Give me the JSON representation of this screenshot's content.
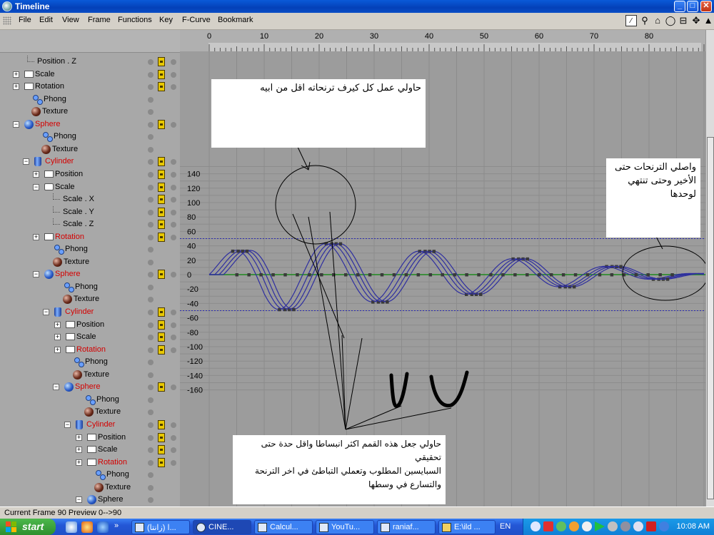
{
  "window": {
    "title": "Timeline",
    "minimize": "_",
    "maximize": "□",
    "close": "✕"
  },
  "menu": [
    "File",
    "Edit",
    "View",
    "Frame",
    "Functions",
    "Key",
    "F-Curve",
    "Bookmark"
  ],
  "toolbar_icons": [
    "fcurve-mode-icon",
    "zoom-icon",
    "home-icon",
    "frame-all-icon",
    "snap-icon",
    "move-icon",
    "warning-icon"
  ],
  "ruler": {
    "frames": [
      "0",
      "10",
      "20",
      "30",
      "40",
      "50",
      "60",
      "70",
      "80"
    ]
  },
  "y_axis": {
    "ticks": [
      "140",
      "120",
      "100",
      "80",
      "60",
      "40",
      "20",
      "0",
      "-20",
      "-40",
      "-60",
      "-80",
      "-100",
      "-120",
      "-140",
      "-160"
    ]
  },
  "tree": [
    {
      "label": "Position . Z",
      "icon": "none",
      "red": false,
      "key": true
    },
    {
      "label": "Scale",
      "icon": "track",
      "red": false,
      "key": true
    },
    {
      "label": "Rotation",
      "icon": "track",
      "red": false,
      "key": true
    },
    {
      "label": "Phong",
      "icon": "phong",
      "red": false,
      "key": false
    },
    {
      "label": "Texture",
      "icon": "texture",
      "red": false,
      "key": false
    },
    {
      "label": "Sphere",
      "icon": "sphere",
      "red": true,
      "key": true
    },
    {
      "label": "Phong",
      "icon": "phong",
      "red": false,
      "key": false
    },
    {
      "label": "Texture",
      "icon": "texture",
      "red": false,
      "key": false
    },
    {
      "label": "Cylinder",
      "icon": "cylinder",
      "red": true,
      "key": true
    },
    {
      "label": "Position",
      "icon": "track",
      "red": false,
      "key": true
    },
    {
      "label": "Scale",
      "icon": "folder",
      "red": false,
      "key": true
    },
    {
      "label": "Scale . X",
      "icon": "none",
      "red": false,
      "key": true
    },
    {
      "label": "Scale . Y",
      "icon": "none",
      "red": false,
      "key": true
    },
    {
      "label": "Scale . Z",
      "icon": "none",
      "red": false,
      "key": true
    },
    {
      "label": "Rotation",
      "icon": "track",
      "red": true,
      "key": true
    },
    {
      "label": "Phong",
      "icon": "phong",
      "red": false,
      "key": false
    },
    {
      "label": "Texture",
      "icon": "texture",
      "red": false,
      "key": false
    },
    {
      "label": "Sphere",
      "icon": "sphere",
      "red": true,
      "key": true
    },
    {
      "label": "Phong",
      "icon": "phong",
      "red": false,
      "key": false
    },
    {
      "label": "Texture",
      "icon": "texture",
      "red": false,
      "key": false
    },
    {
      "label": "Cylinder",
      "icon": "cylinder",
      "red": true,
      "key": true
    },
    {
      "label": "Position",
      "icon": "track",
      "red": false,
      "key": true
    },
    {
      "label": "Scale",
      "icon": "track",
      "red": false,
      "key": true
    },
    {
      "label": "Rotation",
      "icon": "track",
      "red": true,
      "key": true
    },
    {
      "label": "Phong",
      "icon": "phong",
      "red": false,
      "key": false
    },
    {
      "label": "Texture",
      "icon": "texture",
      "red": false,
      "key": false
    },
    {
      "label": "Sphere",
      "icon": "sphere",
      "red": true,
      "key": true
    },
    {
      "label": "Phong",
      "icon": "phong",
      "red": false,
      "key": false
    },
    {
      "label": "Texture",
      "icon": "texture",
      "red": false,
      "key": false
    },
    {
      "label": "Cylinder",
      "icon": "cylinder",
      "red": true,
      "key": true
    },
    {
      "label": "Position",
      "icon": "track",
      "red": false,
      "key": true
    },
    {
      "label": "Scale",
      "icon": "track",
      "red": false,
      "key": true
    },
    {
      "label": "Rotation",
      "icon": "track",
      "red": true,
      "key": true
    },
    {
      "label": "Phong",
      "icon": "phong",
      "red": false,
      "key": false
    },
    {
      "label": "Texture",
      "icon": "texture",
      "red": false,
      "key": false
    },
    {
      "label": "Sphere",
      "icon": "sphere",
      "red": false,
      "key": false
    }
  ],
  "notes": {
    "top": "حاولي عمل كل كيرف ترنحاته اقل من ابيه",
    "right_line1": "واصلي الترنحات حتى",
    "right_line2": "الأخير وحتى تنتهي لوحدها",
    "bottom_line1": "حاولي جعل هذه القمم اكثر انبساطا واقل حدة حتى تحقيقي",
    "bottom_line2": "السبايسين المطلوب وتعملي التباطئ في اخر الترنحة",
    "bottom_line3": "والتسارع في وسطها"
  },
  "status": "Current Frame  90  Preview  0-->90",
  "taskbar": {
    "start": "start",
    "tasks": [
      "(ا (زانتا...",
      "CINE...",
      "Calcul...",
      "YouTu...",
      "raniaf...",
      "E:\\ild ...",
      "EN"
    ],
    "clock": "10:08 AM"
  },
  "colors": {
    "curve": "#2e2ea0",
    "key": "#3a3a3a",
    "zero_line": "#1e8a1e",
    "limit_line": "#2a2ab0",
    "grid": "#8c8c8c",
    "background": "#9c9c9c"
  }
}
